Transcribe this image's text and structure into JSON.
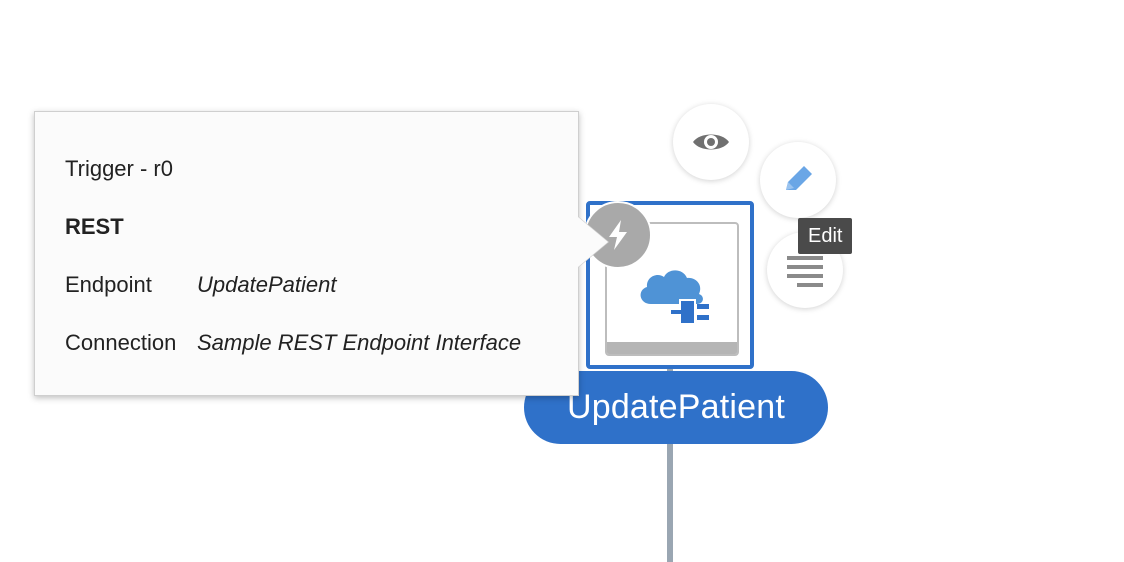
{
  "node": {
    "name": "UpdatePatient",
    "icon": "cloud-plug-icon",
    "accent_color": "#2f71c9"
  },
  "trigger_badge": {
    "icon": "lightning-icon"
  },
  "actions": [
    {
      "name": "view",
      "icon": "eye-icon"
    },
    {
      "name": "edit",
      "icon": "pencil-icon"
    },
    {
      "name": "menu",
      "icon": "menu-lines-icon"
    }
  ],
  "tooltip": {
    "text": "Edit"
  },
  "popover": {
    "title": "Trigger - r0",
    "type": "REST",
    "rows": [
      {
        "label": "Endpoint",
        "value": "UpdatePatient"
      },
      {
        "label": "Connection",
        "value": "Sample REST Endpoint Interface"
      }
    ]
  }
}
